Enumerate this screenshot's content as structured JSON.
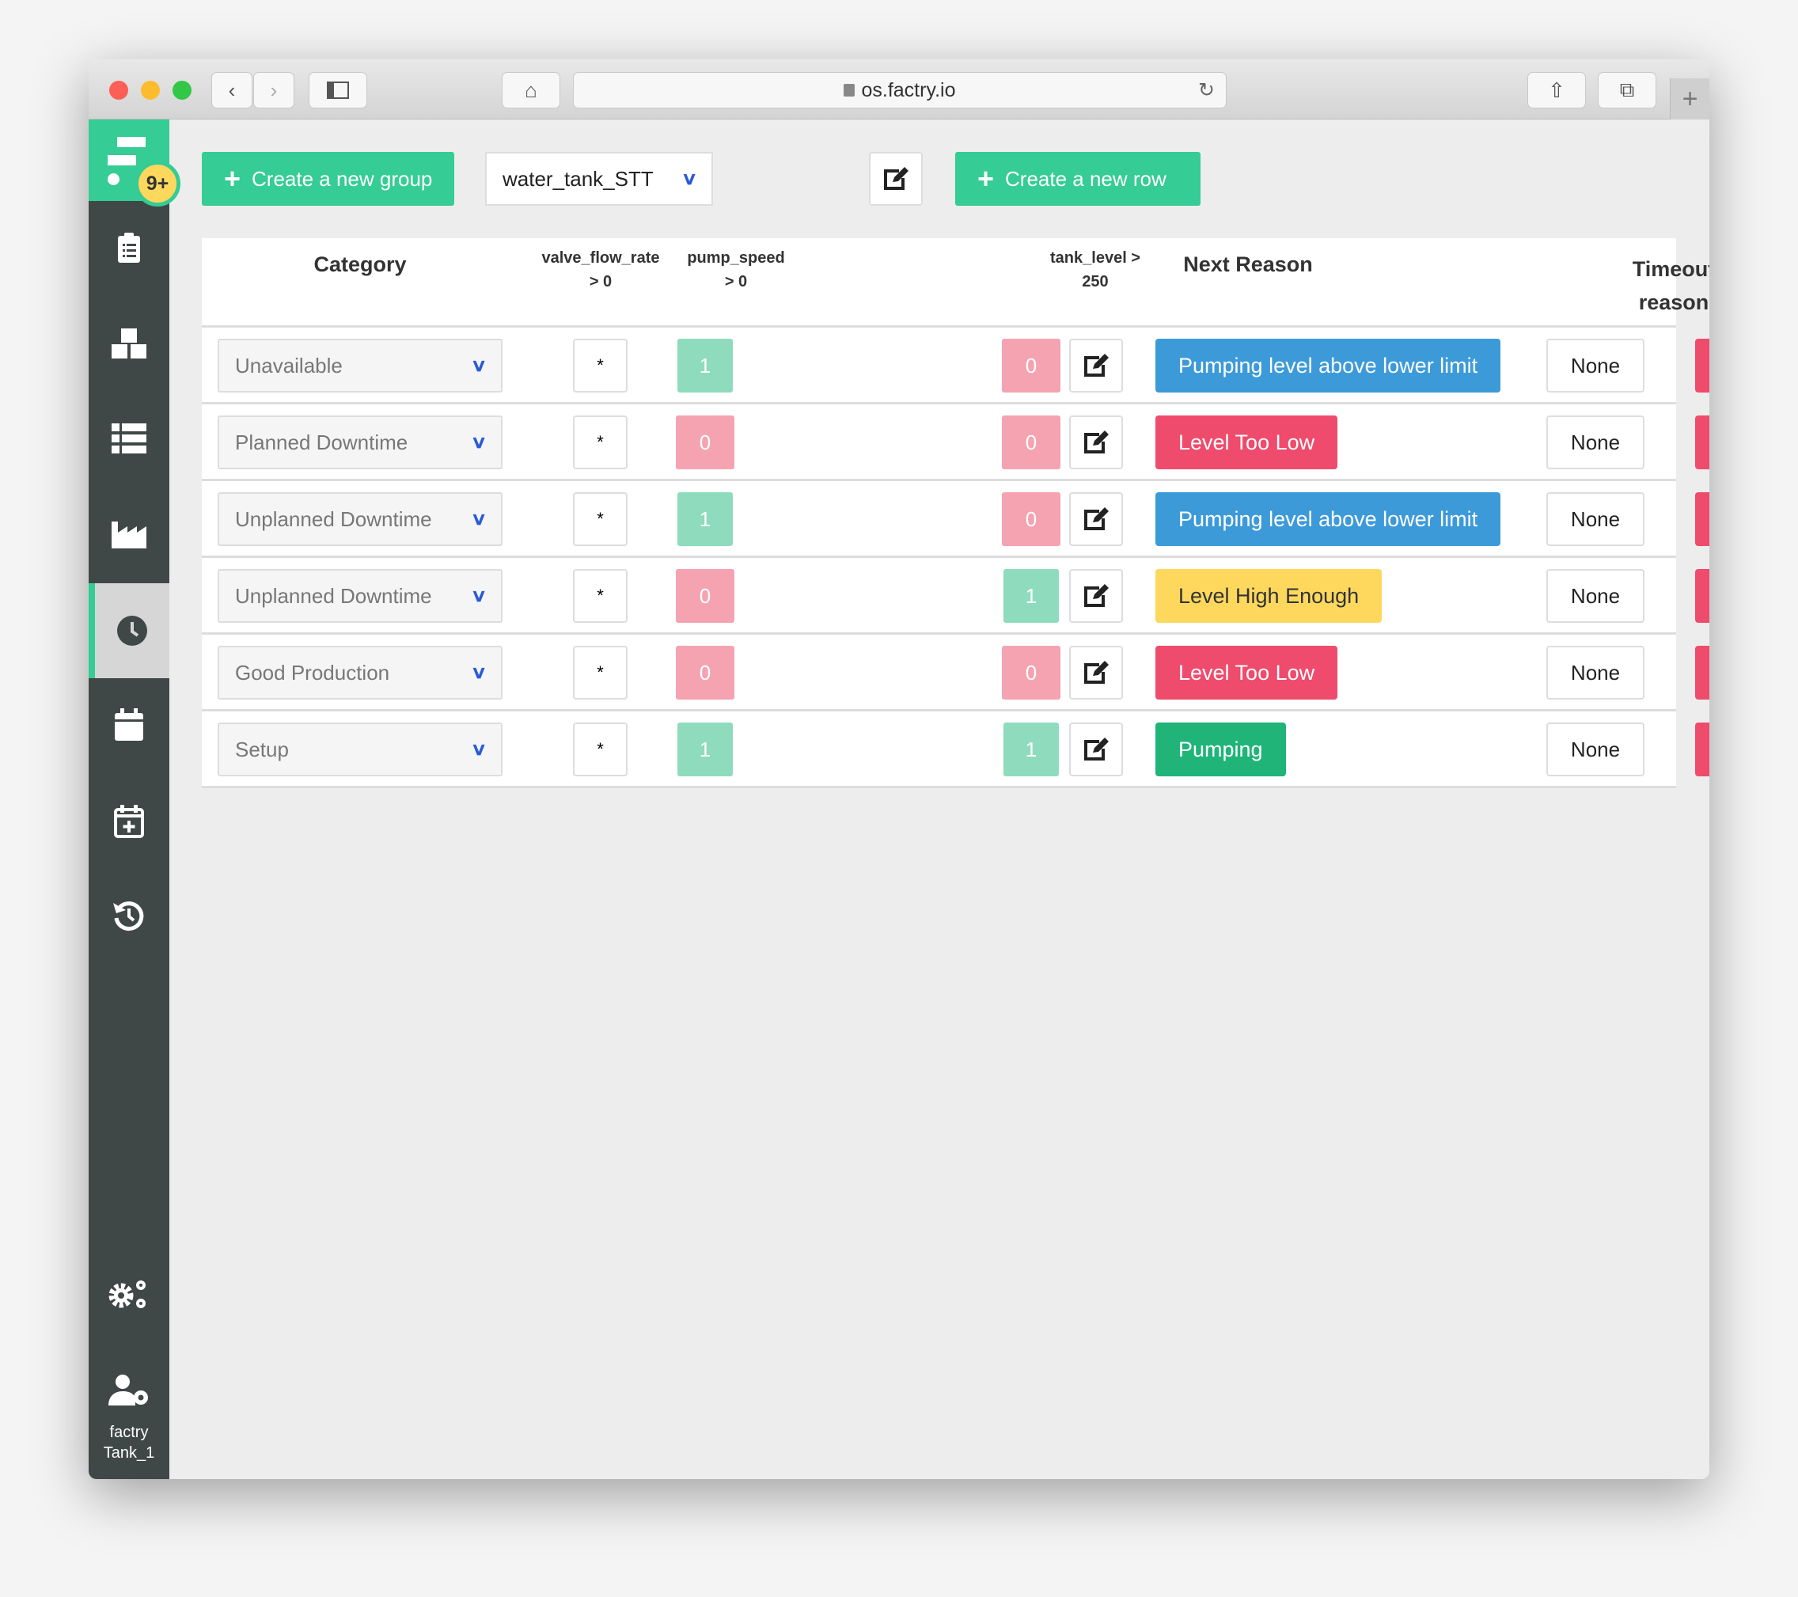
{
  "browser": {
    "url": "os.factry.io"
  },
  "sidebar": {
    "badge": "9+",
    "user_line1": "factry",
    "user_line2": "Tank_1",
    "active": "clock"
  },
  "toolbar": {
    "create_group": "Create a new group",
    "group_select": "water_tank_STT",
    "create_row": "Create a new row"
  },
  "table": {
    "headers": {
      "category": "Category",
      "col1_l1": "valve_flow_rate",
      "col1_l2": "> 0",
      "col2_l1": "pump_speed",
      "col2_l2": "> 0",
      "col3_l1": "tank_level >",
      "col3_l2": "250",
      "next_reason": "Next Reason",
      "timeout_l1": "Timeout",
      "timeout_l2": "reason"
    },
    "rows": [
      {
        "category": "Unavailable",
        "valve": "*",
        "pump": "1",
        "tank": "0",
        "reason": "Pumping level above lower limit",
        "reason_color": "#3d9ad9",
        "timeout": "None"
      },
      {
        "category": "Planned Downtime",
        "valve": "*",
        "pump": "0",
        "tank": "0",
        "reason": "Level Too Low",
        "reason_color": "#ef4b6c",
        "timeout": "None"
      },
      {
        "category": "Unplanned Downtime",
        "valve": "*",
        "pump": "1",
        "tank": "0",
        "reason": "Pumping level above lower limit",
        "reason_color": "#3d9ad9",
        "timeout": "None"
      },
      {
        "category": "Unplanned Downtime",
        "valve": "*",
        "pump": "0",
        "tank": "1",
        "reason": "Level High Enough",
        "reason_color": "#fdd85d",
        "timeout": "None"
      },
      {
        "category": "Good Production",
        "valve": "*",
        "pump": "0",
        "tank": "0",
        "reason": "Level Too Low",
        "reason_color": "#ef4b6c",
        "timeout": "None"
      },
      {
        "category": "Setup",
        "valve": "*",
        "pump": "1",
        "tank": "1",
        "reason": "Pumping",
        "reason_color": "#20b478",
        "timeout": "None"
      }
    ]
  },
  "colors": {
    "brand": "#35cc95",
    "true_cell": "#8edcbd",
    "false_cell": "#f5a3b1",
    "sidebar": "#3f4847",
    "delete": "#ef4b6c"
  }
}
